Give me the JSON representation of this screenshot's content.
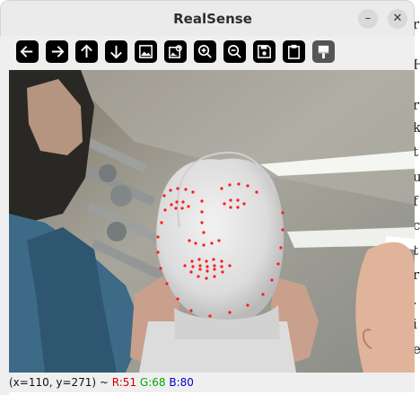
{
  "window": {
    "title": "RealSense",
    "minimize_glyph": "–",
    "close_glyph": "✕"
  },
  "toolbar": {
    "buttons": [
      {
        "name": "pan-left-button",
        "icon": "arrow-left-icon"
      },
      {
        "name": "pan-right-button",
        "icon": "arrow-right-icon"
      },
      {
        "name": "pan-up-button",
        "icon": "arrow-up-icon"
      },
      {
        "name": "pan-down-button",
        "icon": "arrow-down-icon"
      },
      {
        "name": "zoom-image-button",
        "icon": "image-icon"
      },
      {
        "name": "zoom-fit-button",
        "icon": "image-search-icon"
      },
      {
        "name": "zoom-in-button",
        "icon": "zoom-in-icon"
      },
      {
        "name": "zoom-out-button",
        "icon": "zoom-out-icon"
      },
      {
        "name": "save-button",
        "icon": "save-icon"
      },
      {
        "name": "copy-clipboard-button",
        "icon": "clipboard-icon"
      },
      {
        "name": "properties-button",
        "icon": "paint-brush-icon"
      }
    ]
  },
  "status": {
    "coords": "(x=110, y=271) ~ ",
    "r": "R:51",
    "g": "G:68",
    "b": "B:80"
  },
  "colors": {
    "landmark": "#ff1a1a",
    "status_r": "#d10000",
    "status_g": "#00a800",
    "status_b": "#0000d0"
  }
}
